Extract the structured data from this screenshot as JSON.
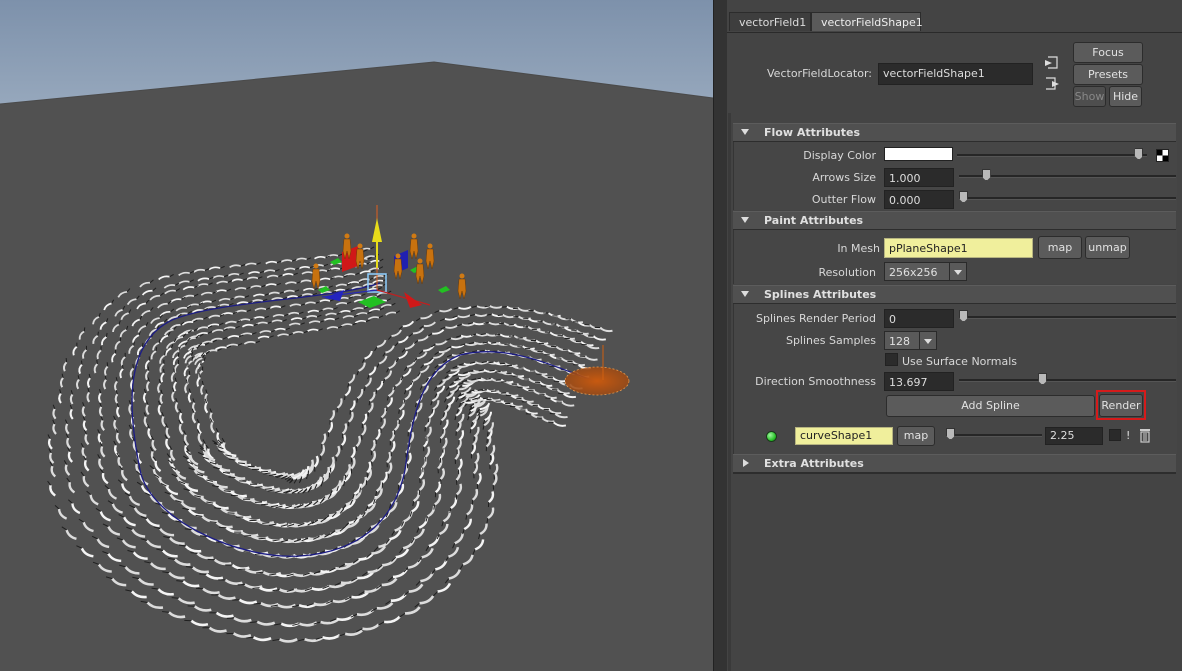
{
  "tabs": [
    {
      "label": "vectorField1",
      "active": false
    },
    {
      "label": "vectorFieldShape1",
      "active": true
    }
  ],
  "header": {
    "locator_label": "VectorFieldLocator:",
    "locator_value": "vectorFieldShape1",
    "focus_label": "Focus",
    "presets_label": "Presets",
    "show_label": "Show",
    "hide_label": "Hide"
  },
  "flow": {
    "title": "Flow Attributes",
    "display_color_label": "Display Color",
    "display_color": "#ffffff",
    "display_color_slider": 0.98,
    "arrows_size_label": "Arrows Size",
    "arrows_size_value": "1.000",
    "arrows_size_slider": 0.11,
    "outter_flow_label": "Outter Flow",
    "outter_flow_value": "0.000",
    "outter_flow_slider": 0.0
  },
  "paint": {
    "title": "Paint Attributes",
    "in_mesh_label": "In Mesh",
    "in_mesh_value": "pPlaneShape1",
    "map_label": "map",
    "unmap_label": "unmap",
    "resolution_label": "Resolution",
    "resolution_value": "256x256"
  },
  "splines": {
    "title": "Splines Attributes",
    "render_period_label": "Splines Render Period",
    "render_period_value": "0",
    "render_period_slider": 0.0,
    "samples_label": "Splines Samples",
    "samples_value": "128",
    "surface_normals_label": "Use Surface Normals",
    "surface_normals_checked": false,
    "smoothness_label": "Direction Smoothness",
    "smoothness_value": "13.697",
    "smoothness_slider": 0.38,
    "add_spline_label": "Add Spline",
    "render_label": "Render",
    "curve_name": "curveShape1",
    "curve_map_label": "map",
    "curve_value": "2.25",
    "curve_slider": 0.0,
    "curve_flag": "!"
  },
  "extra": {
    "title": "Extra Attributes"
  },
  "colors": {
    "sky": "#8ea0b6",
    "ground": "#505050",
    "status_green": "#3ddc3d",
    "highlight_red": "#e01b1b",
    "spline_blue": "#1a1a88"
  }
}
